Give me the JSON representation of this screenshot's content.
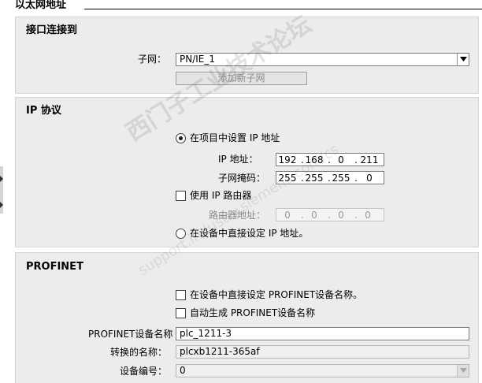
{
  "page": {
    "title": "以太网地址"
  },
  "interface": {
    "title": "接口连接到",
    "subnet_label": "子网：",
    "subnet_value": "PN/IE_1",
    "add_subnet_label": "添加新子网"
  },
  "ip": {
    "title": "IP 协议",
    "set_in_project_label": "在项目中设置 IP 地址",
    "ip_address_label": "IP 地址：",
    "ip_address": [
      "192",
      "168",
      "0",
      "211"
    ],
    "subnet_mask_label": "子网掩码：",
    "subnet_mask": [
      "255",
      "255",
      "255",
      "0"
    ],
    "use_router_label": "使用 IP 路由器",
    "router_address_label": "路由器地址：",
    "router_address": [
      "0",
      "0",
      "0",
      "0"
    ],
    "set_on_device_label": "在设备中直接设定 IP 地址。"
  },
  "profinet": {
    "title": "PROFINET",
    "set_name_on_device_label": "在设备中直接设定 PROFINET设备名称。",
    "auto_generate_label": "自动生成 PROFINET设备名称",
    "device_name_label": "PROFINET设备名称",
    "device_name_value": "plc_1211-3",
    "converted_name_label": "转换的名称：",
    "converted_name_value": "plcxb1211-365af",
    "device_number_label": "设备编号：",
    "device_number_value": "0"
  },
  "watermark": {
    "line1": "西门子工业技术论坛",
    "line2": "support.industry.siemens.com/cs"
  }
}
